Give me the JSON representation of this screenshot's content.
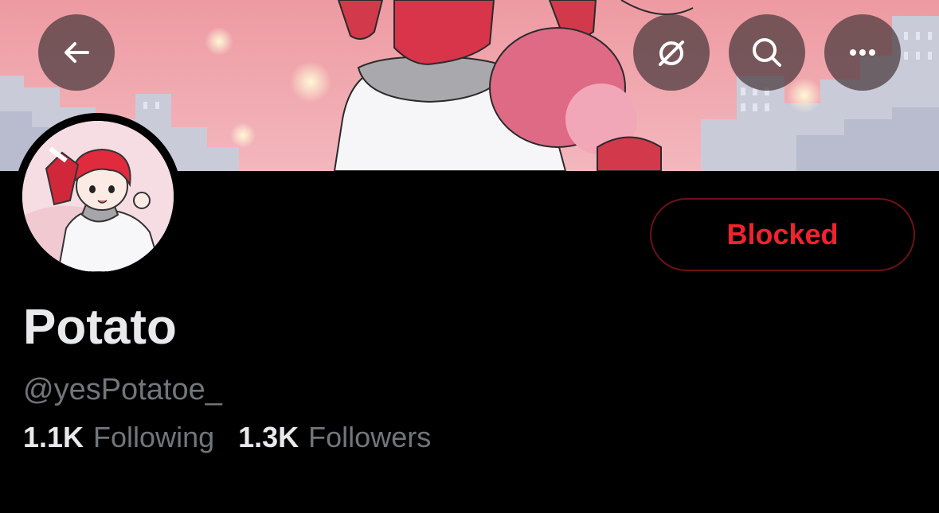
{
  "profile": {
    "display_name": "Potato",
    "handle": "@yesPotatoe_",
    "following_count": "1.1K",
    "following_label": "Following",
    "followers_count": "1.3K",
    "followers_label": "Followers"
  },
  "actions": {
    "blocked_label": "Blocked"
  },
  "icons": {
    "back": "arrow-left-icon",
    "notifications": "bell-slash-icon",
    "search": "search-icon",
    "more": "more-horizontal-icon"
  },
  "colors": {
    "background": "#000000",
    "blocked_text": "#f0232d",
    "blocked_border": "#6e1216",
    "primary_text": "#e7e9ea",
    "secondary_text": "#71767b",
    "banner_sky": "#f1a4aa"
  }
}
